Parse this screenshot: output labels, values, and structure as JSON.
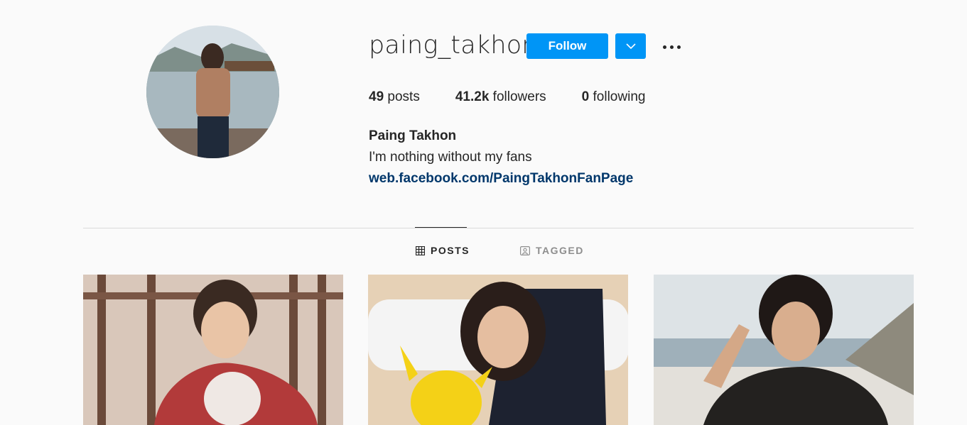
{
  "profile": {
    "username": "paing_takhon",
    "follow_label": "Follow",
    "stats": {
      "posts_count": "49",
      "posts_label": "posts",
      "followers_count": "41.2k",
      "followers_label": "followers",
      "following_count": "0",
      "following_label": "following"
    },
    "full_name": "Paing Takhon",
    "bio": "I'm nothing without my fans",
    "link": "web.facebook.com/PaingTakhonFanPage"
  },
  "tabs": [
    {
      "label": "POSTS",
      "icon": "grid-icon",
      "active": true
    },
    {
      "label": "TAGGED",
      "icon": "tagged-icon",
      "active": false
    }
  ],
  "colors": {
    "accent": "#0095f6",
    "link": "#00376b",
    "text": "#262626",
    "muted": "#8e8e8e"
  }
}
